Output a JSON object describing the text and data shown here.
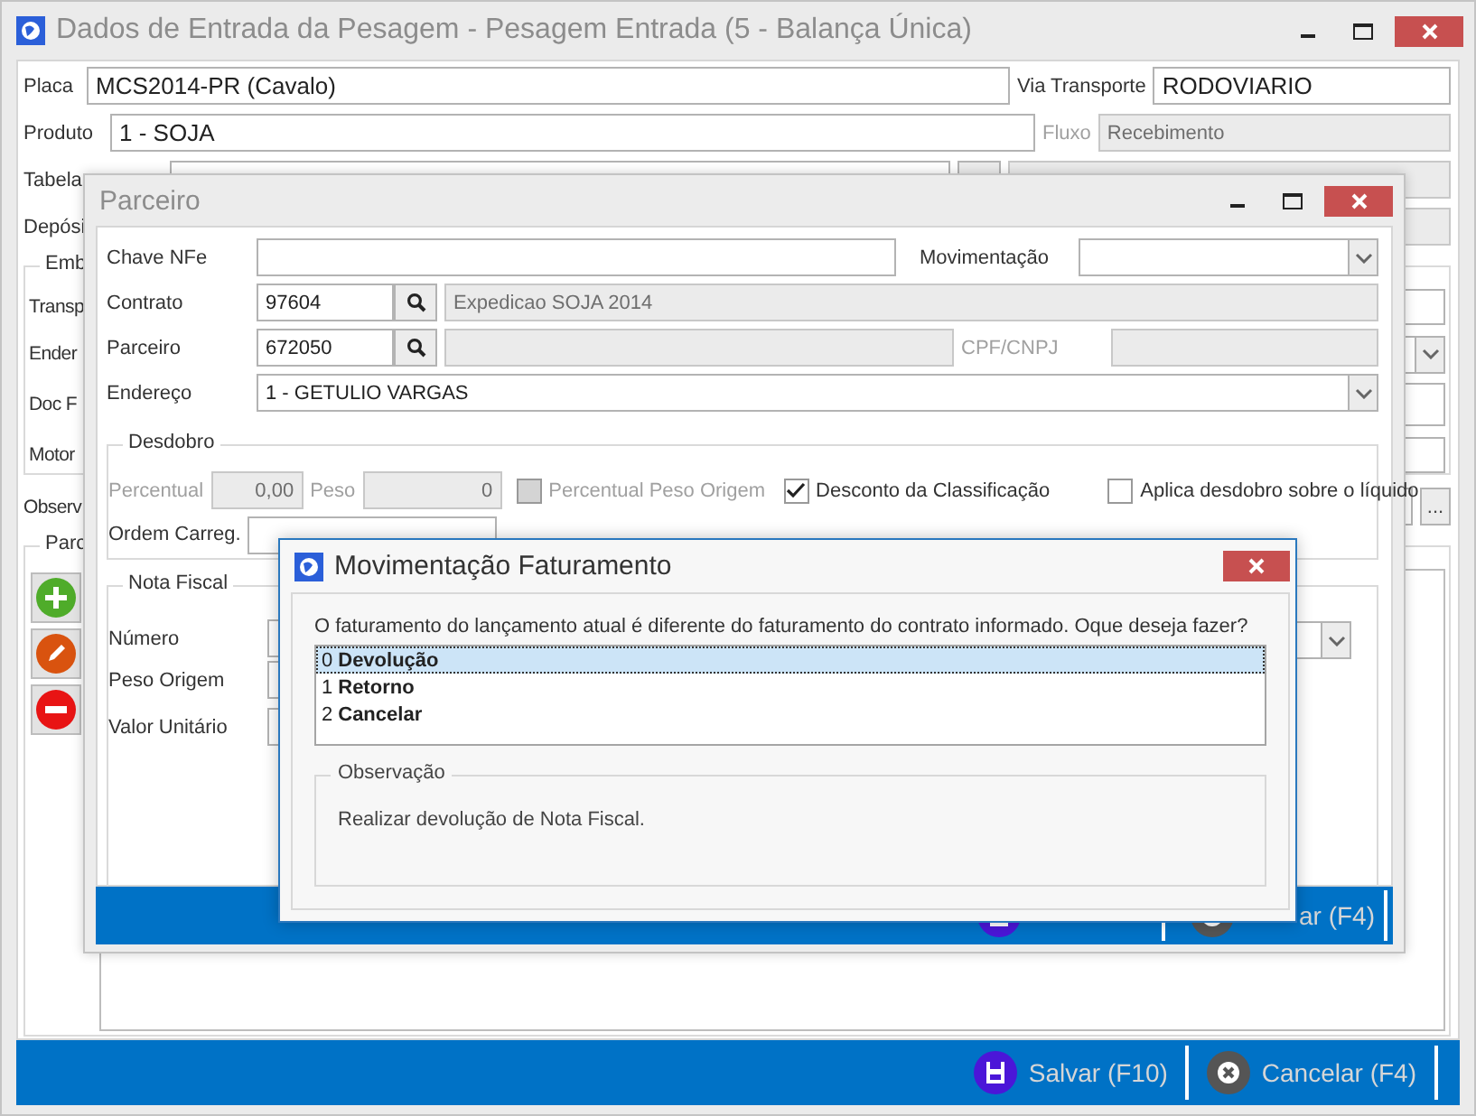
{
  "main": {
    "title": "Dados de Entrada da Pesagem - Pesagem Entrada (5 - Balança Única)",
    "placa": {
      "label": "Placa",
      "value": "MCS2014-PR (Cavalo)"
    },
    "via_transporte": {
      "label": "Via Transporte",
      "value": "RODOVIARIO"
    },
    "produto": {
      "label": "Produto",
      "value": "1 - SOJA"
    },
    "fluxo": {
      "label": "Fluxo",
      "value": "Recebimento",
      "disabled": true
    },
    "row_labels": [
      "Tabela",
      "Depósi"
    ],
    "embarque": {
      "title": "Emb",
      "labels": [
        "Transp",
        "Ender",
        "Doc F",
        "Motor"
      ]
    },
    "observacao_label": "Observ",
    "ellipsis": "...",
    "parcelas_title": "Parc",
    "buttons": [
      {
        "label": "Salvar (F10)",
        "kind": "save"
      },
      {
        "label": "Cancelar (F4)",
        "kind": "cancel"
      }
    ]
  },
  "parceiro": {
    "title": "Parceiro",
    "chave_nfe": {
      "label": "Chave NFe"
    },
    "movimentacao": {
      "label": "Movimentação"
    },
    "contrato": {
      "label": "Contrato",
      "code": "97604",
      "description": "Expedicao SOJA 2014"
    },
    "parceiro_field": {
      "label": "Parceiro",
      "code": "672050"
    },
    "cpf_cnpj": {
      "label": "CPF/CNPJ",
      "disabled": true
    },
    "endereco": {
      "label": "Endereço",
      "value": "1 - GETULIO VARGAS"
    },
    "desdobro": {
      "title": "Desdobro",
      "percentual": {
        "label": "Percentual",
        "value": "0,00",
        "disabled": true
      },
      "peso": {
        "label": "Peso",
        "value": "0",
        "disabled": true
      },
      "checkboxes": [
        {
          "label": "Percentual Peso Origem",
          "checked": false,
          "disabled": true
        },
        {
          "label": "Desconto da Classificação",
          "checked": true,
          "disabled": false
        },
        {
          "label": "Aplica desdobro sobre o líquido",
          "checked": false,
          "disabled": false
        }
      ],
      "ordem_carreg": {
        "label": "Ordem Carreg."
      }
    },
    "nota_fiscal": {
      "title": "Nota Fiscal",
      "labels": [
        "Número",
        "Peso Origem",
        "Valor Unitário"
      ]
    },
    "footer_text": "ar (F4)"
  },
  "dialog": {
    "title": "Movimentação Faturamento",
    "message": "O faturamento do lançamento atual é diferente do faturamento do contrato informado. Oque deseja fazer?",
    "options": [
      {
        "number": "0",
        "label": "Devolução",
        "selected": true
      },
      {
        "number": "1",
        "label": "Retorno",
        "selected": false
      },
      {
        "number": "2",
        "label": "Cancelar",
        "selected": false
      }
    ],
    "observacao": {
      "title": "Observação",
      "text": "Realizar devolução de Nota Fiscal."
    }
  }
}
